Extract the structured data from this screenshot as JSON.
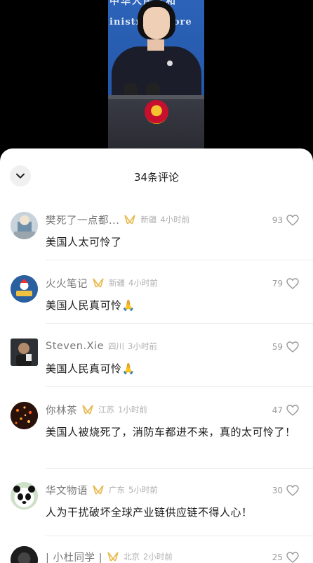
{
  "sheet": {
    "title": "34条评论"
  },
  "comments": [
    {
      "name": "樊死了一点都...",
      "location": "新疆",
      "time": "4小时前",
      "text": "美国人太可怜了",
      "likes": "93",
      "avatar": "avatar-character"
    },
    {
      "name": "火火笔记",
      "location": "新疆",
      "time": "4小时前",
      "text": "美国人民真可怜🙏",
      "likes": "79",
      "avatar": "avatar-notebook-logo"
    },
    {
      "name": "Steven.Xie",
      "location": "四川",
      "time": "3小时前",
      "text": "美国人民真可怜🙏",
      "likes": "59",
      "avatar": "avatar-photo"
    },
    {
      "name": "你林茶",
      "location": "江苏",
      "time": "1小时前",
      "text": "美国人被烧死了，消防车都进不来，真的太可怜了！",
      "likes": "47",
      "avatar": "avatar-sparks"
    },
    {
      "name": "华文物语",
      "location": "广东",
      "time": "5小时前",
      "text": "人为干扰破坏全球产业链供应链不得人心！",
      "likes": "30",
      "avatar": "avatar-panda"
    },
    {
      "name": "| 小杜同学 |",
      "location": "北京",
      "time": "2小时前",
      "text": "",
      "likes": "25",
      "avatar": "avatar-dark"
    }
  ],
  "icons": {
    "collapse": "chevron-down-icon",
    "like": "heart-outline-icon",
    "badge": "gold-badge-icon"
  },
  "colors": {
    "badge": "#e8b84a",
    "meta": "#9a9a9a",
    "text": "#1a1a1a"
  }
}
